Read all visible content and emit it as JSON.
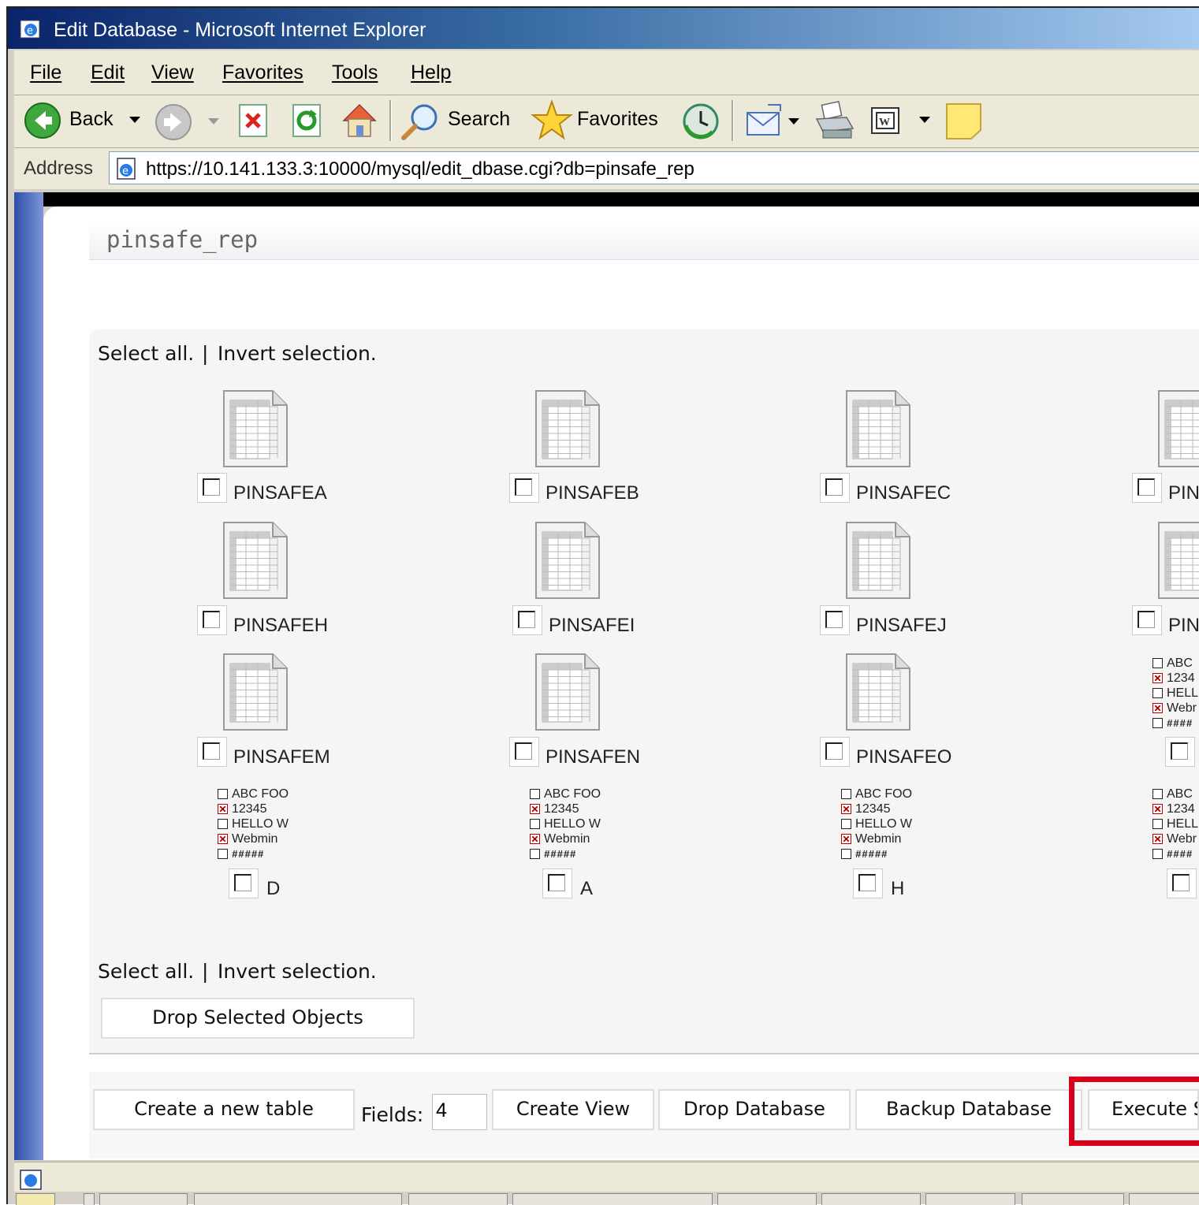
{
  "window": {
    "title": "Edit Database - Microsoft Internet Explorer"
  },
  "menu": {
    "file": "File",
    "edit": "Edit",
    "view": "View",
    "favorites": "Favorites",
    "tools": "Tools",
    "help": "Help"
  },
  "toolbar": {
    "back": "Back",
    "search": "Search",
    "favorites": "Favorites"
  },
  "address": {
    "label": "Address",
    "url": "https://10.141.133.3:10000/mysql/edit_dbase.cgi?db=pinsafe_rep"
  },
  "page": {
    "db_name": "pinsafe_rep",
    "select_all": "Select all.",
    "divider": "|",
    "invert_selection": "Invert selection."
  },
  "tables": [
    {
      "label": "PINSAFEA"
    },
    {
      "label": "PINSAFEB"
    },
    {
      "label": "PINSAFEC"
    },
    {
      "label": "PIN"
    },
    {
      "label": "PINSAFEH"
    },
    {
      "label": "PINSAFEI"
    },
    {
      "label": "PINSAFEJ"
    },
    {
      "label": "PIN"
    },
    {
      "label": "PINSAFEM"
    },
    {
      "label": "PINSAFEN"
    },
    {
      "label": "PINSAFEO"
    }
  ],
  "views": [
    {
      "label": "D"
    },
    {
      "label": "A"
    },
    {
      "label": "H"
    }
  ],
  "view_icon_rows": {
    "full": [
      "ABC FOO",
      "12345",
      "HELLO W",
      "Webmin",
      "#####"
    ],
    "cut": [
      "ABC",
      "1234",
      "HELL",
      "Webr",
      "####"
    ]
  },
  "buttons": {
    "drop_selected": "Drop Selected Objects",
    "create_table": "Create a new table",
    "fields_label": "Fields:",
    "fields_value": "4",
    "create_view": "Create View",
    "drop_database": "Drop Database",
    "backup_database": "Backup Database",
    "execute_sql": "Execute S"
  },
  "colors": {
    "highlight_box": "#d9001b",
    "title_gradient_start": "#0a246a"
  }
}
